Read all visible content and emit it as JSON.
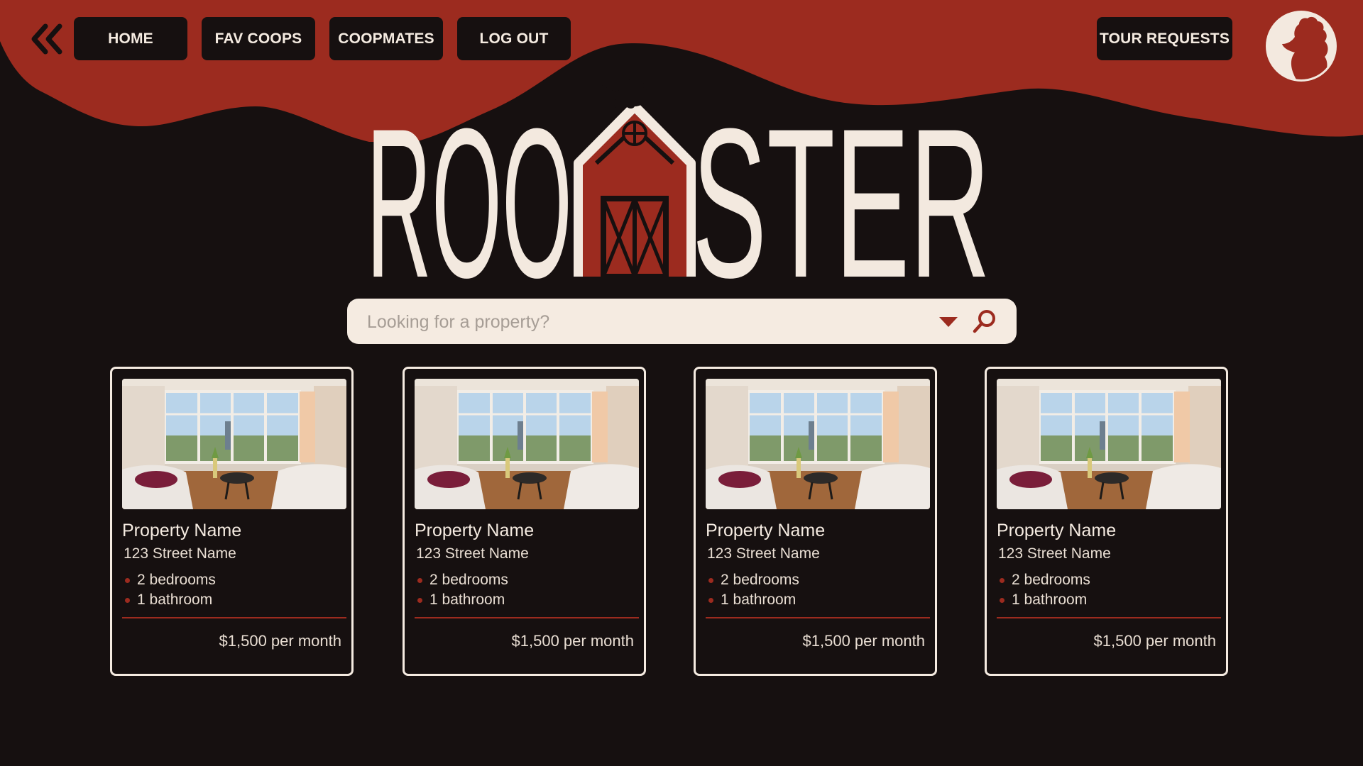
{
  "colors": {
    "accent_red": "#9c2b1f",
    "background": "#161010",
    "cream": "#f5ebe1"
  },
  "nav": {
    "back_icon": "double-chevron-left-icon",
    "home": "HOME",
    "fav_coops": "FAV COOPS",
    "coopmates": "COOPMATES",
    "log_out": "LOG OUT",
    "tour_requests": "TOUR REQUESTS",
    "avatar_icon": "rooster-avatar-icon"
  },
  "logo": {
    "text": "ROOMASTER",
    "left_text": "ROO",
    "right_text": "STER",
    "icon": "barn-rooster-logo"
  },
  "search": {
    "placeholder": "Looking for a property?",
    "dropdown_icon": "caret-down-icon",
    "search_icon": "search-icon"
  },
  "listings": [
    {
      "name": "Property Name",
      "address": "123 Street Name",
      "features": [
        "2 bedrooms",
        "1 bathroom"
      ],
      "price": "$1,500 per month"
    },
    {
      "name": "Property Name",
      "address": "123 Street Name",
      "features": [
        "2 bedrooms",
        "1 bathroom"
      ],
      "price": "$1,500 per month"
    },
    {
      "name": "Property Name",
      "address": "123 Street Name",
      "features": [
        "2 bedrooms",
        "1 bathroom"
      ],
      "price": "$1,500 per month"
    },
    {
      "name": "Property Name",
      "address": "123 Street Name",
      "features": [
        "2 bedrooms",
        "1 bathroom"
      ],
      "price": "$1,500 per month"
    }
  ]
}
